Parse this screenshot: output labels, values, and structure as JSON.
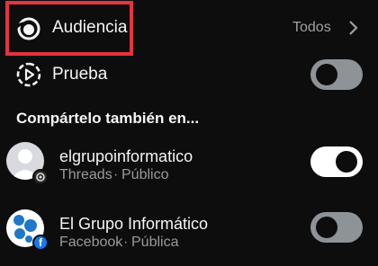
{
  "audience": {
    "label": "Audiencia",
    "value": "Todos"
  },
  "test": {
    "label": "Prueba",
    "enabled": false
  },
  "share_section": {
    "title": "Compártelo también en..."
  },
  "accounts": [
    {
      "name": "elgrupoinformatico",
      "platform": "Threads",
      "visibility": "Público",
      "enabled": true
    },
    {
      "name": "El Grupo Informático",
      "platform": "Facebook",
      "visibility": "Pública",
      "enabled": false
    }
  ],
  "colors": {
    "highlight": "#e5333f",
    "background": "#0d0d0d",
    "facebook": "#1877f2"
  }
}
